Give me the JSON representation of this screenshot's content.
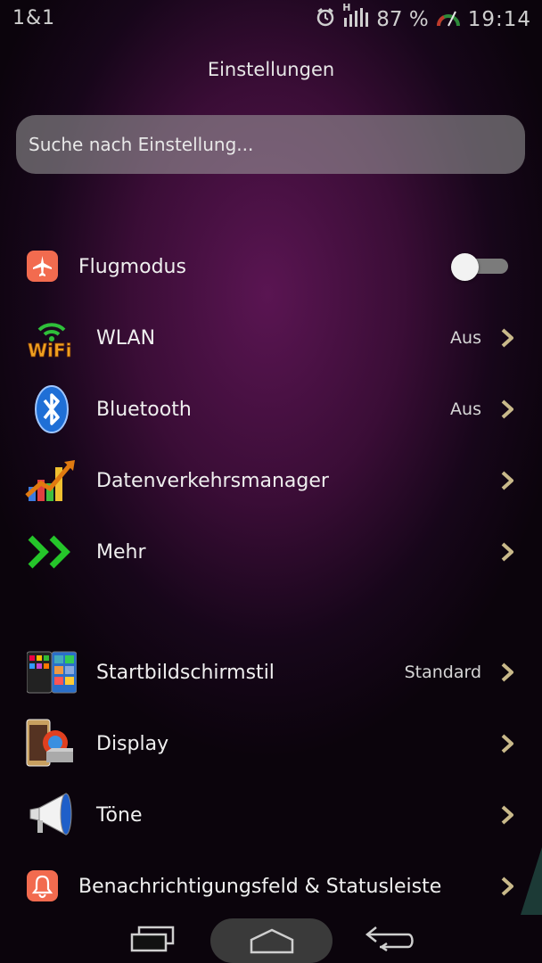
{
  "status": {
    "carrier": "1&1",
    "network": "H",
    "battery": "87 %",
    "time": "19:14"
  },
  "header": {
    "title": "Einstellungen"
  },
  "search": {
    "placeholder": "Suche nach Einstellung..."
  },
  "group1": [
    {
      "label": "Flugmodus",
      "toggle_on": false,
      "icon": "airplane-icon"
    },
    {
      "label": "WLAN",
      "value": "Aus",
      "icon": "wifi-icon"
    },
    {
      "label": "Bluetooth",
      "value": "Aus",
      "icon": "bluetooth-icon"
    },
    {
      "label": "Datenverkehrsmanager",
      "value": "",
      "icon": "data-chart-icon"
    },
    {
      "label": "Mehr",
      "value": "",
      "icon": "double-chevron-icon"
    }
  ],
  "group2": [
    {
      "label": "Startbildschirmstil",
      "value": "Standard",
      "icon": "home-style-icon"
    },
    {
      "label": "Display",
      "value": "",
      "icon": "display-icon"
    },
    {
      "label": "Töne",
      "value": "",
      "icon": "megaphone-icon"
    },
    {
      "label": "Benachrichtigungsfeld & Statusleiste",
      "value": "",
      "icon": "bell-icon"
    }
  ],
  "colors": {
    "accent_orange": "#f26b4f",
    "background": "#3a0d36",
    "toggle_track": "#7b7b7b"
  }
}
